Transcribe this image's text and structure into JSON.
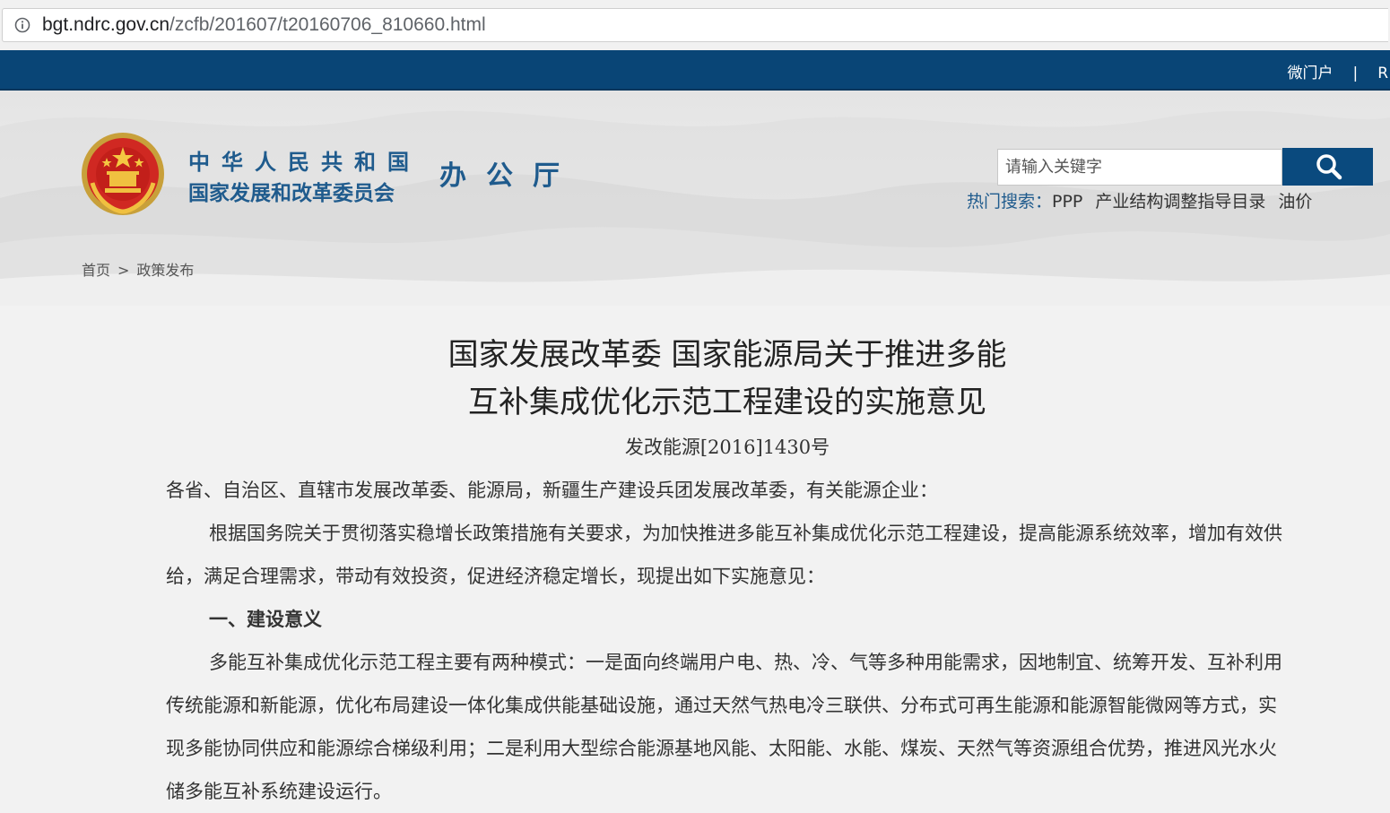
{
  "browser": {
    "url_host": "bgt.ndrc.gov.cn",
    "url_path": "/zcfb/201607/t20160706_810660.html"
  },
  "topbar": {
    "micro_portal": "微门户",
    "separator": "|",
    "cut_link": "R"
  },
  "header": {
    "org_line1": "中华人民共和国",
    "org_line2": "国家发展和改革委员会",
    "office": "办公厅",
    "search_placeholder": "请输入关键字",
    "hot_search_label": "热门搜索：",
    "hot_search_items": [
      "PPP",
      "产业结构调整指导目录",
      "油价"
    ]
  },
  "breadcrumb": {
    "home": "首页",
    "separator": ">",
    "current": "政策发布"
  },
  "article": {
    "title_line1": "国家发展改革委 国家能源局关于推进多能",
    "title_line2": "互补集成优化示范工程建设的实施意见",
    "doc_number": "发改能源[2016]1430号",
    "salutation": "各省、自治区、直辖市发展改革委、能源局，新疆生产建设兵团发展改革委，有关能源企业：",
    "paragraph1": "根据国务院关于贯彻落实稳增长政策措施有关要求，为加快推进多能互补集成优化示范工程建设，提高能源系统效率，增加有效供给，满足合理需求，带动有效投资，促进经济稳定增长，现提出如下实施意见：",
    "heading1": "一、建设意义",
    "paragraph2": "多能互补集成优化示范工程主要有两种模式：一是面向终端用户电、热、冷、气等多种用能需求，因地制宜、统筹开发、互补利用传统能源和新能源，优化布局建设一体化集成供能基础设施，通过天然气热电冷三联供、分布式可再生能源和能源智能微网等方式，实现多能协同供应和能源综合梯级利用；二是利用大型综合能源基地风能、太阳能、水能、煤炭、天然气等资源组合优势，推进风光水火储多能互补系统建设运行。"
  },
  "colors": {
    "topbar": "#094576",
    "brand_text": "#1f5b8d",
    "search_button": "#0a4a7e",
    "page_background": "#f2f2f2"
  },
  "icons": {
    "info": "info-icon",
    "search": "search-icon",
    "emblem": "national-emblem-icon"
  }
}
